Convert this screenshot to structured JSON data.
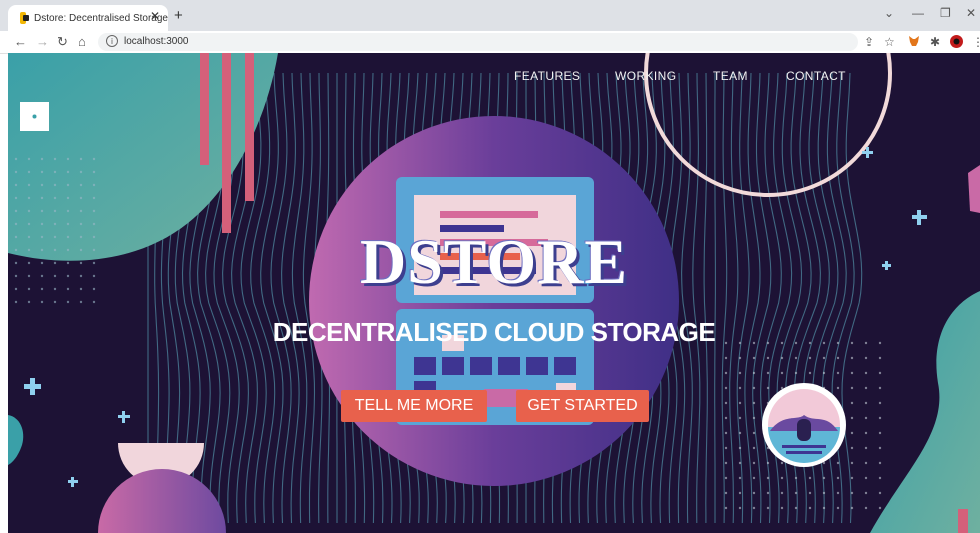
{
  "browser": {
    "tab_title": "Dstore: Decentralised Storage",
    "url": "localhost:3000",
    "close_glyph": "✕",
    "new_tab_glyph": "+",
    "back_glyph": "←",
    "forward_glyph": "→",
    "reload_glyph": "↻",
    "home_glyph": "⌂",
    "info_glyph": "i",
    "minimize_glyph": "—",
    "restore_glyph": "❐",
    "window_close_glyph": "✕",
    "tabs_dropdown_glyph": "⌄",
    "share_glyph": "⇪",
    "star_glyph": "☆",
    "extensions_glyph": "✱",
    "menu_glyph": "⋮"
  },
  "nav": {
    "items": [
      "FEATURES",
      "WORKING",
      "TEAM",
      "CONTACT"
    ]
  },
  "hero": {
    "title": "DSTORE",
    "subtitle": "DECENTRALISED CLOUD STORAGE",
    "buttons": [
      "TELL ME MORE",
      "GET STARTED"
    ]
  },
  "colors": {
    "background": "#1d1235",
    "accent_button": "#e8614c",
    "teal": "#4fa6a6",
    "pink": "#d4607a",
    "laptop_blue": "#5aa5d6"
  }
}
